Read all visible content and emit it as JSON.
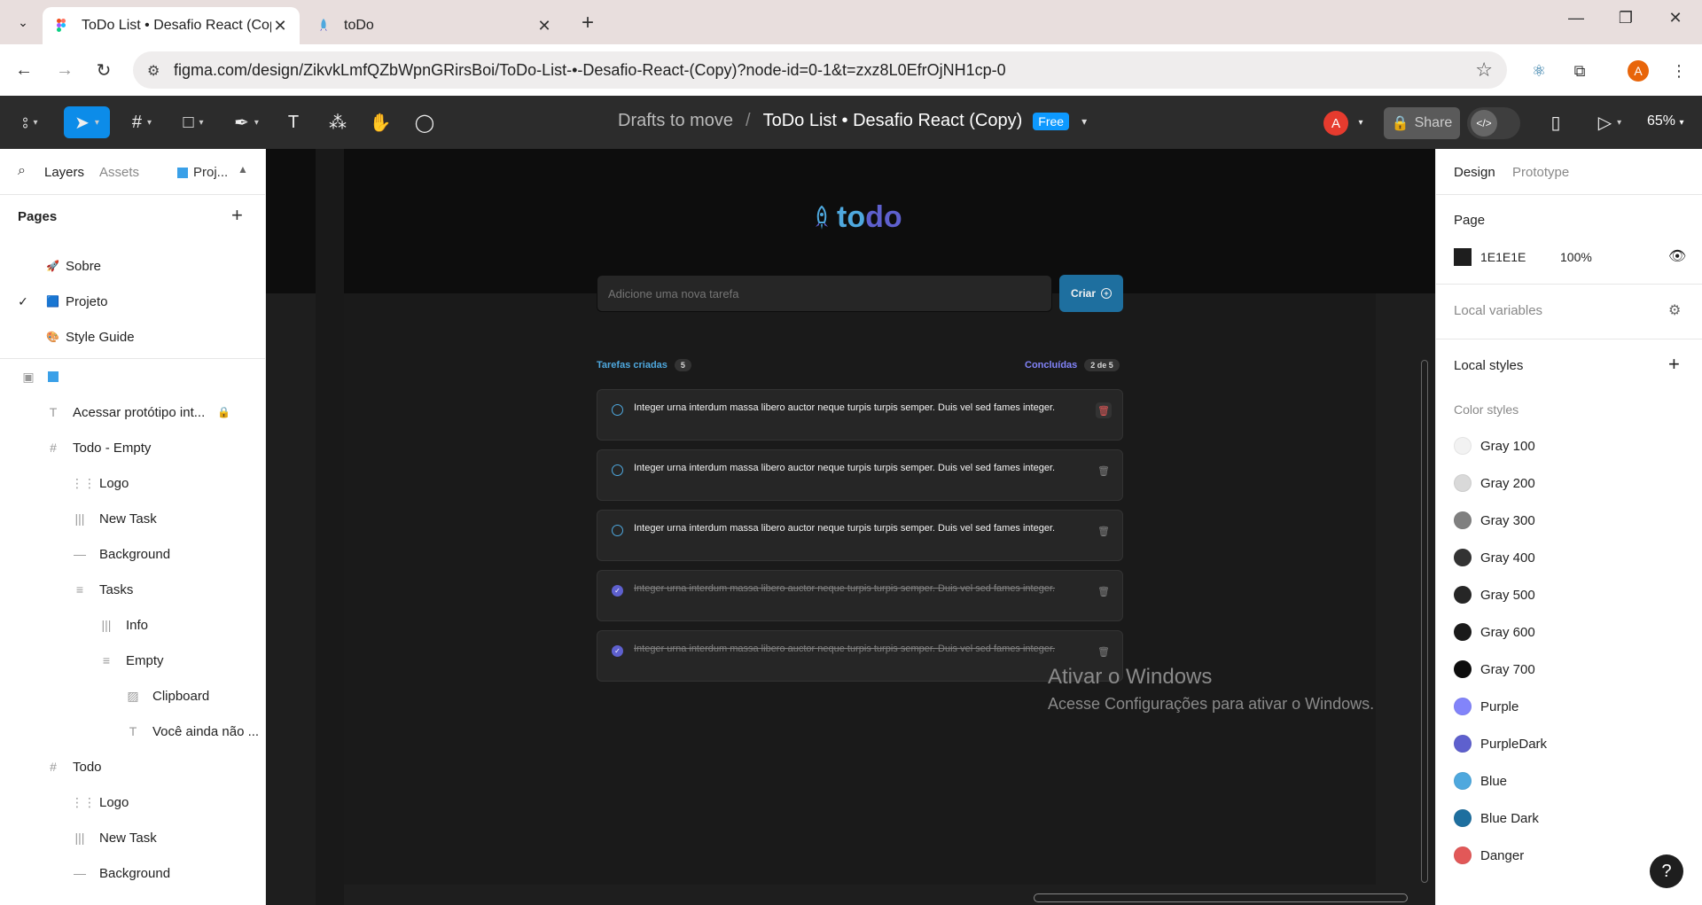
{
  "browser": {
    "tabs": [
      {
        "title": "ToDo List • Desafio React (Copy)"
      },
      {
        "title": "toDo"
      }
    ],
    "url": "figma.com/design/ZikvkLmfQZbWpnGRirsBoi/ToDo-List-•-Desafio-React-(Copy)?node-id=0-1&t=zxz8L0EfrOjNH1cp-0",
    "profile_initial": "A"
  },
  "figma": {
    "breadcrumb_folder": "Drafts to move",
    "breadcrumb_separator": "/",
    "file_name": "ToDo List • Desafio React (Copy)",
    "plan_badge": "Free",
    "avatar_initial": "A",
    "share_label": "Share",
    "zoom": "65%"
  },
  "left_panel": {
    "tabs": {
      "layers": "Layers",
      "assets": "Assets",
      "project": "Proj..."
    },
    "pages_title": "Pages",
    "pages": [
      {
        "emoji": "🚀",
        "label": "Sobre",
        "selected": false
      },
      {
        "emoji": "🟦",
        "label": "Projeto",
        "selected": true
      },
      {
        "emoji": "🎨",
        "label": "Style Guide",
        "selected": false
      }
    ],
    "layers": [
      {
        "icon": "T",
        "label": "Acessar protótipo int...",
        "indent": 0
      },
      {
        "icon": "#",
        "label": "Todo - Empty",
        "indent": 0
      },
      {
        "icon": "⋮⋮",
        "label": "Logo",
        "indent": 1
      },
      {
        "icon": "|||",
        "label": "New Task",
        "indent": 1
      },
      {
        "icon": "—",
        "label": "Background",
        "indent": 1
      },
      {
        "icon": "≡",
        "label": "Tasks",
        "indent": 1
      },
      {
        "icon": "|||",
        "label": "Info",
        "indent": 2
      },
      {
        "icon": "≡",
        "label": "Empty",
        "indent": 2
      },
      {
        "icon": "▨",
        "label": "Clipboard",
        "indent": 3
      },
      {
        "icon": "T",
        "label": "Você ainda não ...",
        "indent": 3
      },
      {
        "icon": "#",
        "label": "Todo",
        "indent": 0
      },
      {
        "icon": "⋮⋮",
        "label": "Logo",
        "indent": 1
      },
      {
        "icon": "|||",
        "label": "New Task",
        "indent": 1
      },
      {
        "icon": "—",
        "label": "Background",
        "indent": 1
      }
    ]
  },
  "canvas": {
    "logo_prefix": "to",
    "logo_suffix": "do",
    "input_placeholder": "Adicione uma nova tarefa",
    "create_button": "Criar",
    "created_label": "Tarefas criadas",
    "created_count": "5",
    "done_label": "Concluídas",
    "done_count": "2 de 5",
    "tasks": [
      {
        "text": "Integer urna interdum massa libero auctor neque turpis turpis semper. Duis vel sed fames integer.",
        "done": false
      },
      {
        "text": "Integer urna interdum massa libero auctor neque turpis turpis semper. Duis vel sed fames integer.",
        "done": false
      },
      {
        "text": "Integer urna interdum massa libero auctor neque turpis turpis semper. Duis vel sed fames integer.",
        "done": false
      },
      {
        "text": "Integer urna interdum massa libero auctor neque turpis turpis semper. Duis vel sed fames integer.",
        "done": true
      },
      {
        "text": "Integer urna interdum massa libero auctor neque turpis turpis semper. Duis vel sed fames integer.",
        "done": true
      }
    ],
    "watermark_title": "Ativar o Windows",
    "watermark_sub": "Acesse Configurações para ativar o Windows."
  },
  "right_panel": {
    "tabs": {
      "design": "Design",
      "prototype": "Prototype"
    },
    "page_title": "Page",
    "page_color_hex": "1E1E1E",
    "page_color": "#1e1e1e",
    "page_opacity": "100%",
    "local_variables": "Local variables",
    "local_styles": "Local styles",
    "color_styles_title": "Color styles",
    "colors": [
      {
        "name": "Gray 100",
        "hex": "#f2f2f2"
      },
      {
        "name": "Gray 200",
        "hex": "#d9d9d9"
      },
      {
        "name": "Gray 300",
        "hex": "#808080"
      },
      {
        "name": "Gray 400",
        "hex": "#333333"
      },
      {
        "name": "Gray 500",
        "hex": "#262626"
      },
      {
        "name": "Gray 600",
        "hex": "#1a1a1a"
      },
      {
        "name": "Gray 700",
        "hex": "#0d0d0d"
      },
      {
        "name": "Purple",
        "hex": "#8284fa"
      },
      {
        "name": "PurpleDark",
        "hex": "#5e60ce"
      },
      {
        "name": "Blue",
        "hex": "#4ea8de"
      },
      {
        "name": "Blue Dark",
        "hex": "#1e6f9f"
      },
      {
        "name": "Danger",
        "hex": "#e25858"
      }
    ],
    "help": "?"
  }
}
